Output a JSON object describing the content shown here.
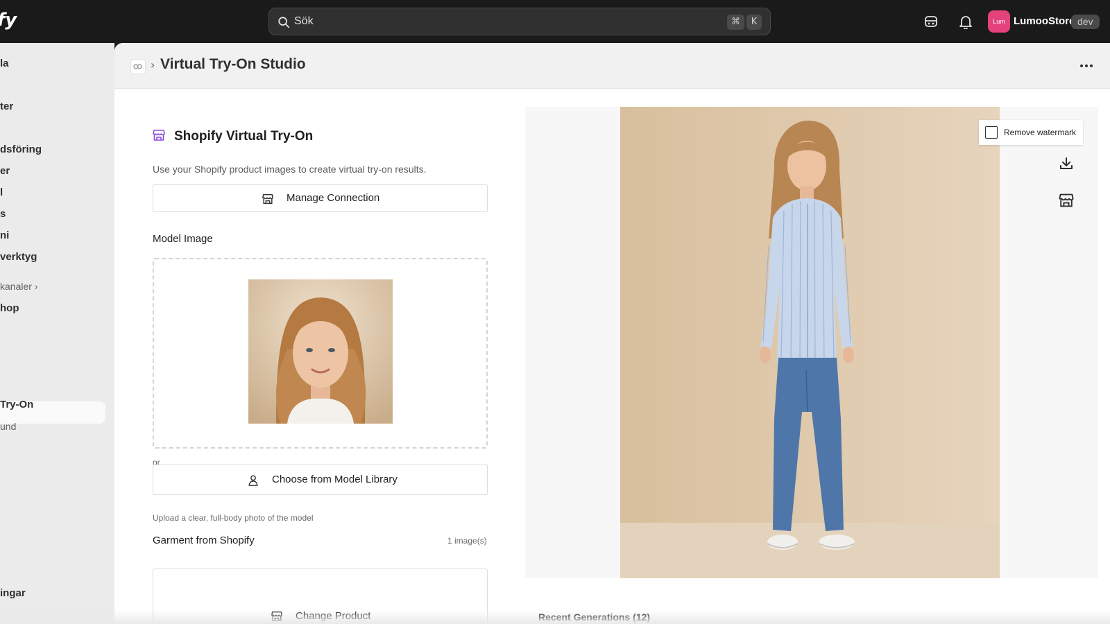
{
  "topbar": {
    "brand_partial": "fy",
    "search": {
      "placeholder": "Sök",
      "shortcut_cmd": "⌘",
      "shortcut_key": "K"
    },
    "account": {
      "avatar_text": "Lum",
      "store_name": "LumooStore",
      "badge": "dev"
    },
    "icons": [
      "search-icon",
      "magic-icon",
      "bell-icon"
    ]
  },
  "sidebar": {
    "items": [
      {
        "label": "la"
      },
      {
        "label": "ter"
      },
      {
        "label": "dsföring"
      },
      {
        "label": "er"
      },
      {
        "label": "l"
      },
      {
        "label": "s"
      },
      {
        "label": "ni"
      },
      {
        "label": "verktyg"
      },
      {
        "label": "kanaler ›"
      },
      {
        "label": "hop"
      },
      {
        "label": "Try-On"
      },
      {
        "label": "und"
      },
      {
        "label": "ingar"
      }
    ]
  },
  "header": {
    "separator": "›",
    "title": "Virtual Try-On Studio"
  },
  "panel": {
    "title": "Shopify Virtual Try-On",
    "description": "Use your Shopify product images to create virtual try-on results.",
    "manage_connection": "Manage Connection",
    "model_image_label": "Model Image",
    "or_text": "or",
    "choose_model_library": "Choose from Model Library",
    "upload_hint": "Upload a clear, full-body photo of the model",
    "garment_label": "Garment from Shopify",
    "garment_count": "1 image(s)",
    "change_product": "Change Product"
  },
  "preview": {
    "remove_watermark": "Remove watermark",
    "remove_watermark_checked": false,
    "recent_generations": "Recent Generations (12)"
  },
  "colors": {
    "topbar_bg": "#1a1a1a",
    "sidebar_bg": "#ebebeb",
    "accent_purple": "#8a4ddb",
    "avatar_pink": "#e3427a",
    "photo_backdrop": "#d8bf9d"
  }
}
